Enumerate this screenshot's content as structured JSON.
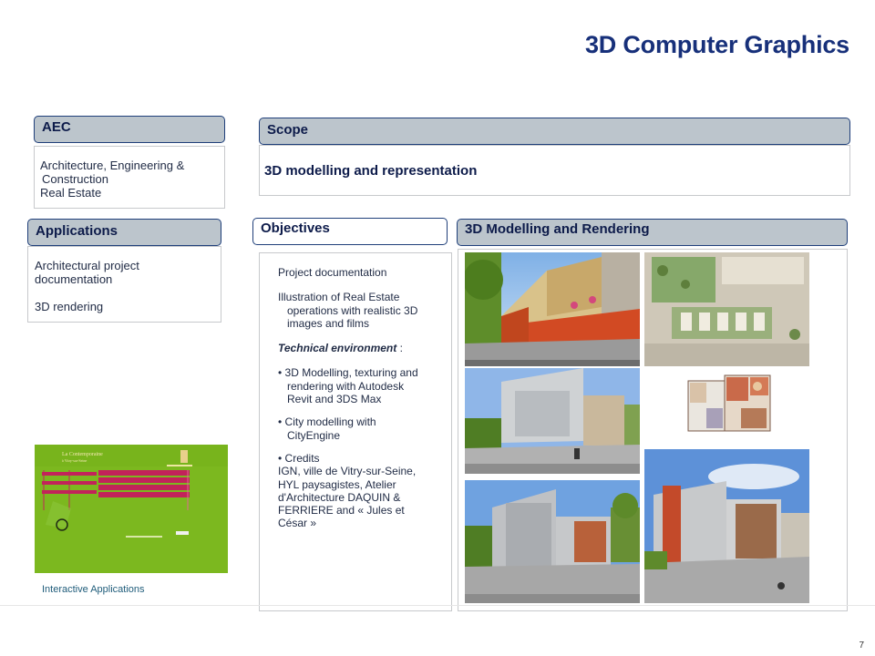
{
  "page": {
    "title": "3D Computer Graphics",
    "page_number": "7"
  },
  "aec": {
    "header": "AEC",
    "line1": "Architecture, Engineering &",
    "line2": "Construction",
    "line3": "Real Estate"
  },
  "scope": {
    "header": "Scope",
    "body": "3D modelling and representation"
  },
  "applications": {
    "header": "Applications",
    "line1": "Architectural project",
    "line2": "documentation",
    "line3": "3D rendering",
    "caption": "Interactive Applications"
  },
  "objectives": {
    "header": "Objectives",
    "p1": "Project documentation",
    "p2_l1": "Illustration of Real Estate",
    "p2_l2": "operations with realistic 3D",
    "p2_l3": "images and films",
    "tech": "Technical environment",
    "tech_colon": " :",
    "b1_l1": "3D Modelling, texturing and",
    "b1_l2": "rendering with Autodesk",
    "b1_l3": "Revit and 3DS Max",
    "b2_l1": "City modelling with",
    "b2_l2": "CityEngine",
    "b3": "Credits",
    "c_l1": "IGN, ville de Vitry-sur-Seine,",
    "c_l2": "HYL paysagistes, Atelier",
    "c_l3": "d'Architecture DAQUIN &",
    "c_l4": "FERRIERE and « Jules et",
    "c_l5": "César »"
  },
  "rendering": {
    "header": "3D Modelling and Rendering"
  },
  "colors": {
    "title": "#17307a",
    "header_fill": "#bcc5cc",
    "header_border": "#1f3f7a",
    "app_green": "#79b51c",
    "app_magenta": "#c2235a"
  },
  "icons": {
    "bullet": "•"
  }
}
